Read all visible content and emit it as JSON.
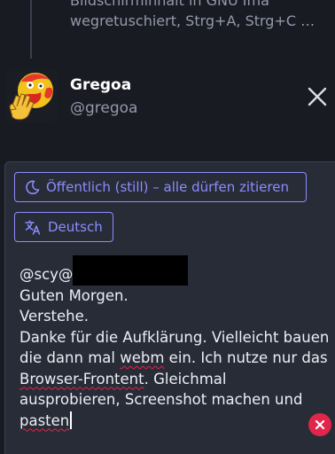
{
  "quoted_post": {
    "line1": "Bildschirminhalt in GNU Ima",
    "line2": "wegretuschiert, Strg+A, Strg+C …"
  },
  "author": {
    "display_name": "Gregoa",
    "handle": "@gregoa"
  },
  "compose": {
    "visibility_label": "Öffentlich (still) – alle dürfen zitieren",
    "language_label": "Deutsch",
    "text": {
      "mention": "@scy@",
      "line2": "Guten Morgen.",
      "line3": "Verstehe.",
      "line4": "Danke für die Aufklärung. Vielleicht bauen",
      "line5_pre": "die dann mal ",
      "line5_word": "webm",
      "line5_post": " ein. Ich nutze nur das",
      "line6_word": "Browser-Frontent",
      "line6_post": ". Gleichmal",
      "line7": "ausprobieren, Screenshot machen und",
      "line8_word": "pasten"
    }
  },
  "colors": {
    "background": "#191b22",
    "compose_background": "#282c37",
    "accent": "#8c8dff",
    "error": "#e0264b",
    "secondary_text": "#9299aa"
  },
  "icons": {
    "visibility": "moon-icon",
    "language": "translate-icon",
    "close": "close-icon",
    "clear": "clear-icon"
  }
}
